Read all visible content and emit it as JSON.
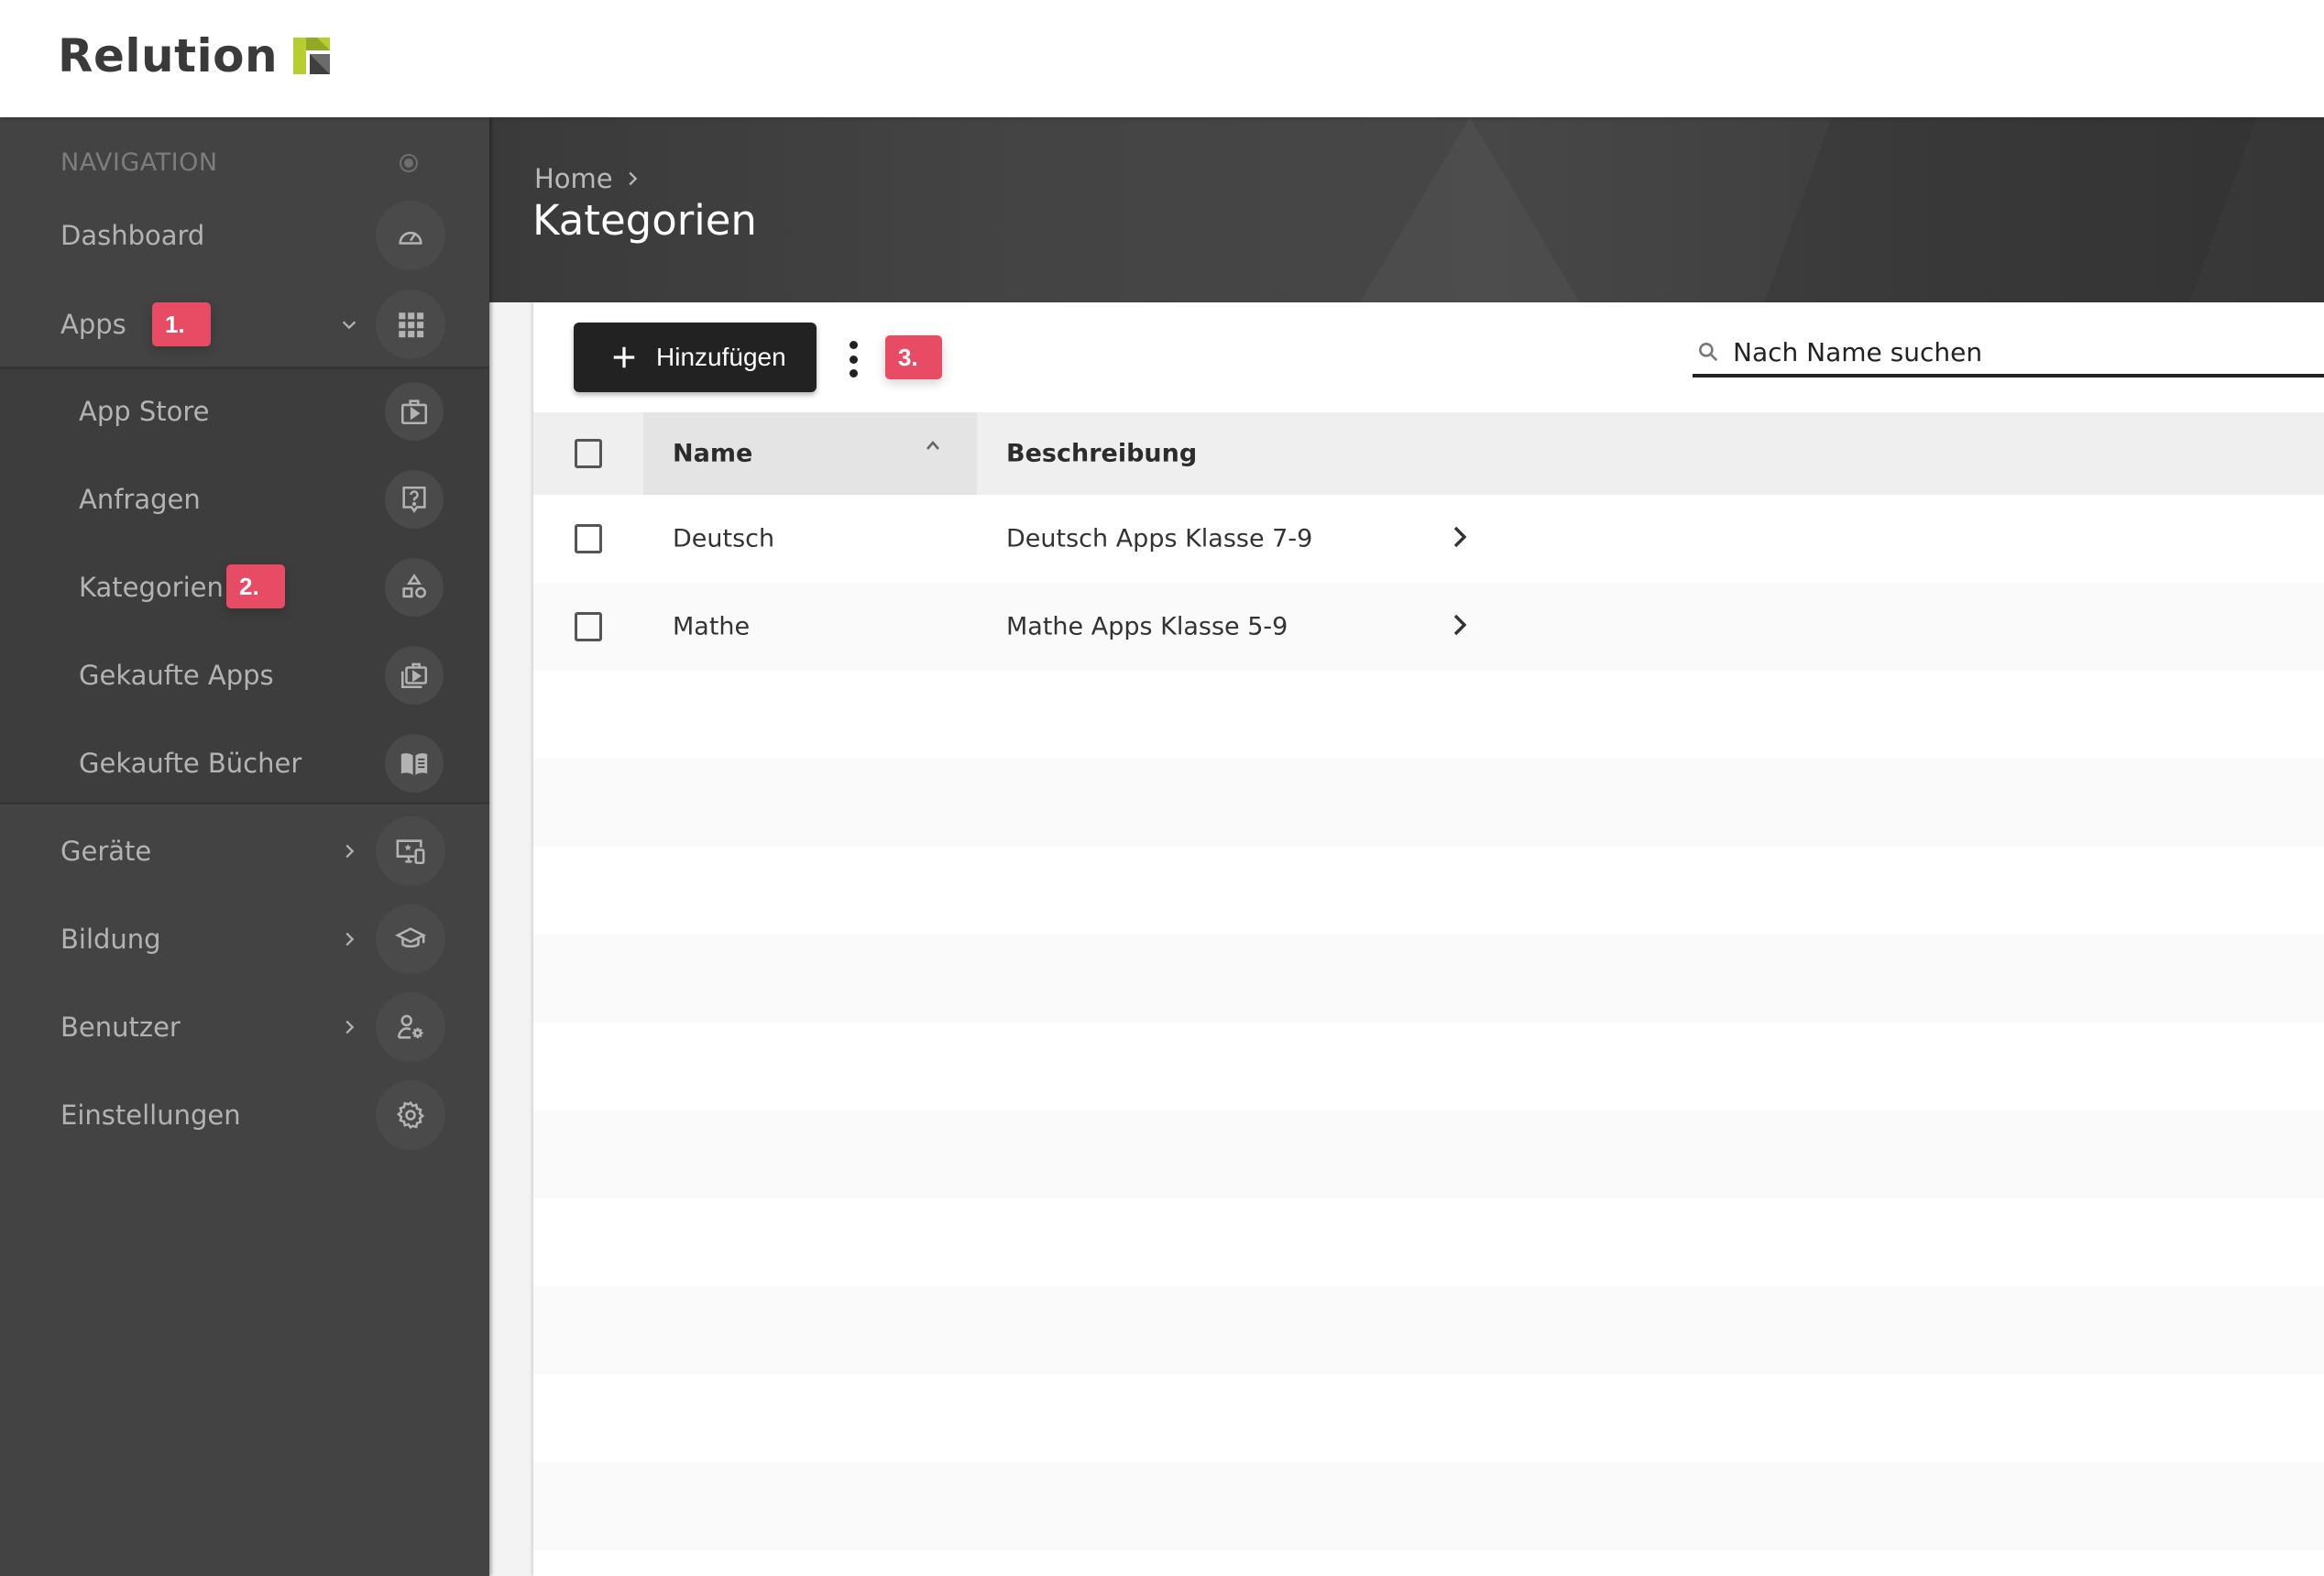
{
  "app": {
    "logo_text": "Relution",
    "brand_colors": {
      "green": "#b6cf2e",
      "dark": "#3a3a3a"
    }
  },
  "sidebar": {
    "header": "NAVIGATION",
    "items": [
      {
        "label": "Dashboard",
        "icon": "speedometer-icon",
        "level": 0
      },
      {
        "label": "Apps",
        "icon": "apps-grid-icon",
        "level": 0,
        "expanded": true,
        "badge": "1."
      },
      {
        "label": "App Store",
        "icon": "app-store-briefcase-icon",
        "level": 1
      },
      {
        "label": "Anfragen",
        "icon": "question-bubble-icon",
        "level": 1
      },
      {
        "label": "Kategorien",
        "icon": "shapes-icon",
        "level": 1,
        "badge": "2.",
        "active": true
      },
      {
        "label": "Gekaufte Apps",
        "icon": "purchased-apps-icon",
        "level": 1
      },
      {
        "label": "Gekaufte Bücher",
        "icon": "book-icon",
        "level": 1
      },
      {
        "label": "Geräte",
        "icon": "devices-icon",
        "level": 0,
        "expandable": true
      },
      {
        "label": "Bildung",
        "icon": "graduation-cap-icon",
        "level": 0,
        "expandable": true
      },
      {
        "label": "Benutzer",
        "icon": "user-settings-icon",
        "level": 0,
        "expandable": true
      },
      {
        "label": "Einstellungen",
        "icon": "gear-icon",
        "level": 0
      }
    ]
  },
  "header": {
    "breadcrumb": [
      "Home"
    ],
    "title": "Kategorien"
  },
  "toolbar": {
    "add_label": "Hinzufügen",
    "badge": "3.",
    "search_placeholder": "Nach Name suchen",
    "search_value": ""
  },
  "table": {
    "columns": [
      {
        "label": "Name",
        "sorted": "ascending"
      },
      {
        "label": "Beschreibung"
      }
    ],
    "rows": [
      {
        "name": "Deutsch",
        "description": "Deutsch Apps Klasse 7-9"
      },
      {
        "name": "Mathe",
        "description": "Mathe Apps Klasse 5-9"
      }
    ]
  },
  "annotation_color": "#e84c64"
}
